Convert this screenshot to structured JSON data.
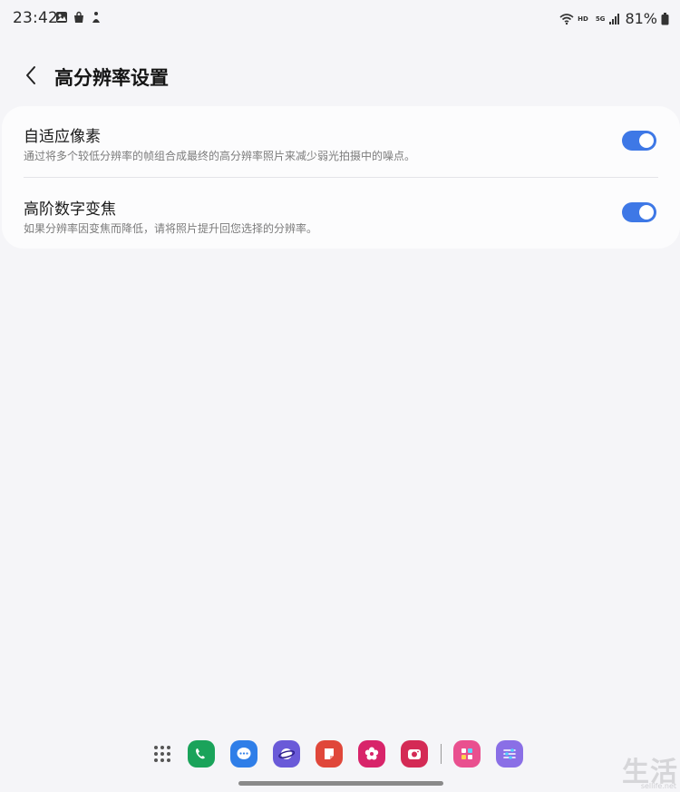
{
  "status_bar": {
    "time": "23:42",
    "battery": "81%",
    "network_label": "HD",
    "signal_label": "5G"
  },
  "header": {
    "title": "高分辨率设置"
  },
  "settings": [
    {
      "title": "自适应像素",
      "description": "通过将多个较低分辨率的帧组合成最终的高分辨率照片来减少弱光拍摄中的噪点。",
      "enabled": true
    },
    {
      "title": "高阶数字变焦",
      "description": "如果分辨率因变焦而降低，请将照片提升回您选择的分辨率。",
      "enabled": true
    }
  ],
  "colors": {
    "toggle_on": "#3e78e6",
    "background": "#f5f5f8",
    "card": "#fcfcfd"
  },
  "dock": {
    "apps": [
      {
        "name": "phone-icon",
        "color": "#1aa35a"
      },
      {
        "name": "messages-icon",
        "color": "#2f7ee8"
      },
      {
        "name": "internet-icon",
        "color": "#6a5ad8"
      },
      {
        "name": "notes-icon",
        "color": "#e0473a"
      },
      {
        "name": "gallery-icon",
        "color": "#d8246a"
      },
      {
        "name": "camera-icon",
        "color": "#d42a55"
      },
      {
        "name": "store-icon",
        "color": "#e9508f"
      },
      {
        "name": "settings-icon",
        "color": "#8a6fe6"
      }
    ]
  },
  "watermark": {
    "text": "生活",
    "sub": "sellife.net"
  }
}
